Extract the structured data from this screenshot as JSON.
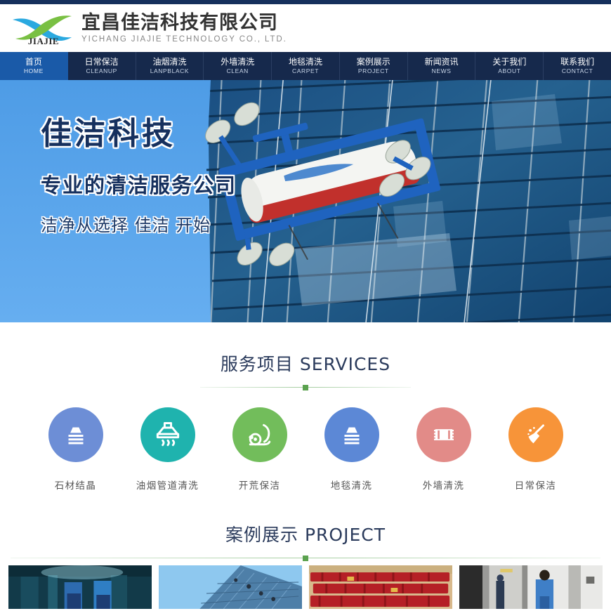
{
  "site": {
    "accent_navy": "#16294c",
    "accent_blue": "#1a5aa8",
    "accent_green": "#5ba24f",
    "hero_sky": "#5aa3e8"
  },
  "header": {
    "logo_mark_name": "jiajie-swoosh-logo",
    "logo_wordmark": "JIAJIE",
    "company_cn": "宜昌佳洁科技有限公司",
    "company_en": "YICHANG  JIAJIE  TECHNOLOGY CO., LTD."
  },
  "nav": {
    "items": [
      {
        "cn": "首页",
        "en": "HOME",
        "active": true
      },
      {
        "cn": "日常保洁",
        "en": "CLEANUP",
        "active": false
      },
      {
        "cn": "油烟清洗",
        "en": "LANPBLACK",
        "active": false
      },
      {
        "cn": "外墙清洗",
        "en": "CLEAN",
        "active": false
      },
      {
        "cn": "地毯清洗",
        "en": "CARPET",
        "active": false
      },
      {
        "cn": "案例展示",
        "en": "PROJECT",
        "active": false
      },
      {
        "cn": "新闻资讯",
        "en": "NEWS",
        "active": false
      },
      {
        "cn": "关于我们",
        "en": "ABOUT",
        "active": false
      },
      {
        "cn": "联系我们",
        "en": "CONTACT",
        "active": false
      }
    ]
  },
  "hero": {
    "line1": "佳洁科技",
    "line2": "专业的清洁服务公司",
    "line3": "洁净从选择 佳洁 开始",
    "image_alt": "高空作业平台清洗玻璃幕墙"
  },
  "services_section": {
    "title": "服务项目 SERVICES",
    "items": [
      {
        "label": "石材结晶",
        "color": "#6d8ed6",
        "icon": "stone-crystal-icon"
      },
      {
        "label": "油烟管道清洗",
        "color": "#1fb3ae",
        "icon": "range-hood-icon"
      },
      {
        "label": "开荒保洁",
        "color": "#72bd5b",
        "icon": "vacuum-cleaner-icon"
      },
      {
        "label": "地毯清洗",
        "color": "#5c88d6",
        "icon": "carpet-stack-icon"
      },
      {
        "label": "外墙清洗",
        "color": "#e28b88",
        "icon": "curtain-wall-icon"
      },
      {
        "label": "日常保洁",
        "color": "#f79439",
        "icon": "broom-icon"
      }
    ]
  },
  "projects_section": {
    "title": "案例展示  PROJECT",
    "thumbnails": [
      {
        "caption_alt": "厨房设备清洗作业"
      },
      {
        "caption_alt": "玻璃幕墙高空清洗"
      },
      {
        "caption_alt": "会议厅座椅地毯清洁"
      },
      {
        "caption_alt": "电梯间日常保洁"
      }
    ]
  }
}
